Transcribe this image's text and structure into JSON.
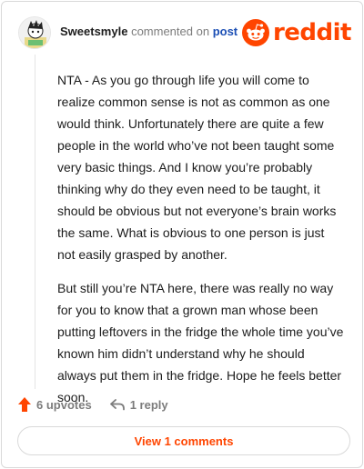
{
  "header": {
    "username": "Sweetsmyle",
    "action_text": "commented on",
    "post_link": "post",
    "logo_text": "reddit"
  },
  "comment": {
    "paragraphs": [
      "NTA - As you go through life you will come to realize common sense is not as common as one would think. Unfortunately there are quite a few people in the world who’ve not been taught some very basic things. And I know you’re probably thinking why do they even need to be taught, it should be obvious but not everyone’s brain works the same. What is obvious to one person is just not easily grasped by another.",
      "But still you’re NTA here, there was really no way for you to know that a grown man whose been putting leftovers in the fridge the whole time you’ve known him didn’t understand why he should always put them in the fridge. Hope he feels better soon."
    ]
  },
  "actions": {
    "upvotes": "6 upvotes",
    "replies": "1 reply"
  },
  "footer": {
    "view_comments": "View 1 comments"
  },
  "colors": {
    "brand": "#ff4500",
    "link": "#1c4fb5",
    "muted": "#7c7c7c"
  },
  "icons": [
    "avatar",
    "reddit-snoo-icon",
    "upvote-arrow-icon",
    "reply-arrow-icon"
  ]
}
